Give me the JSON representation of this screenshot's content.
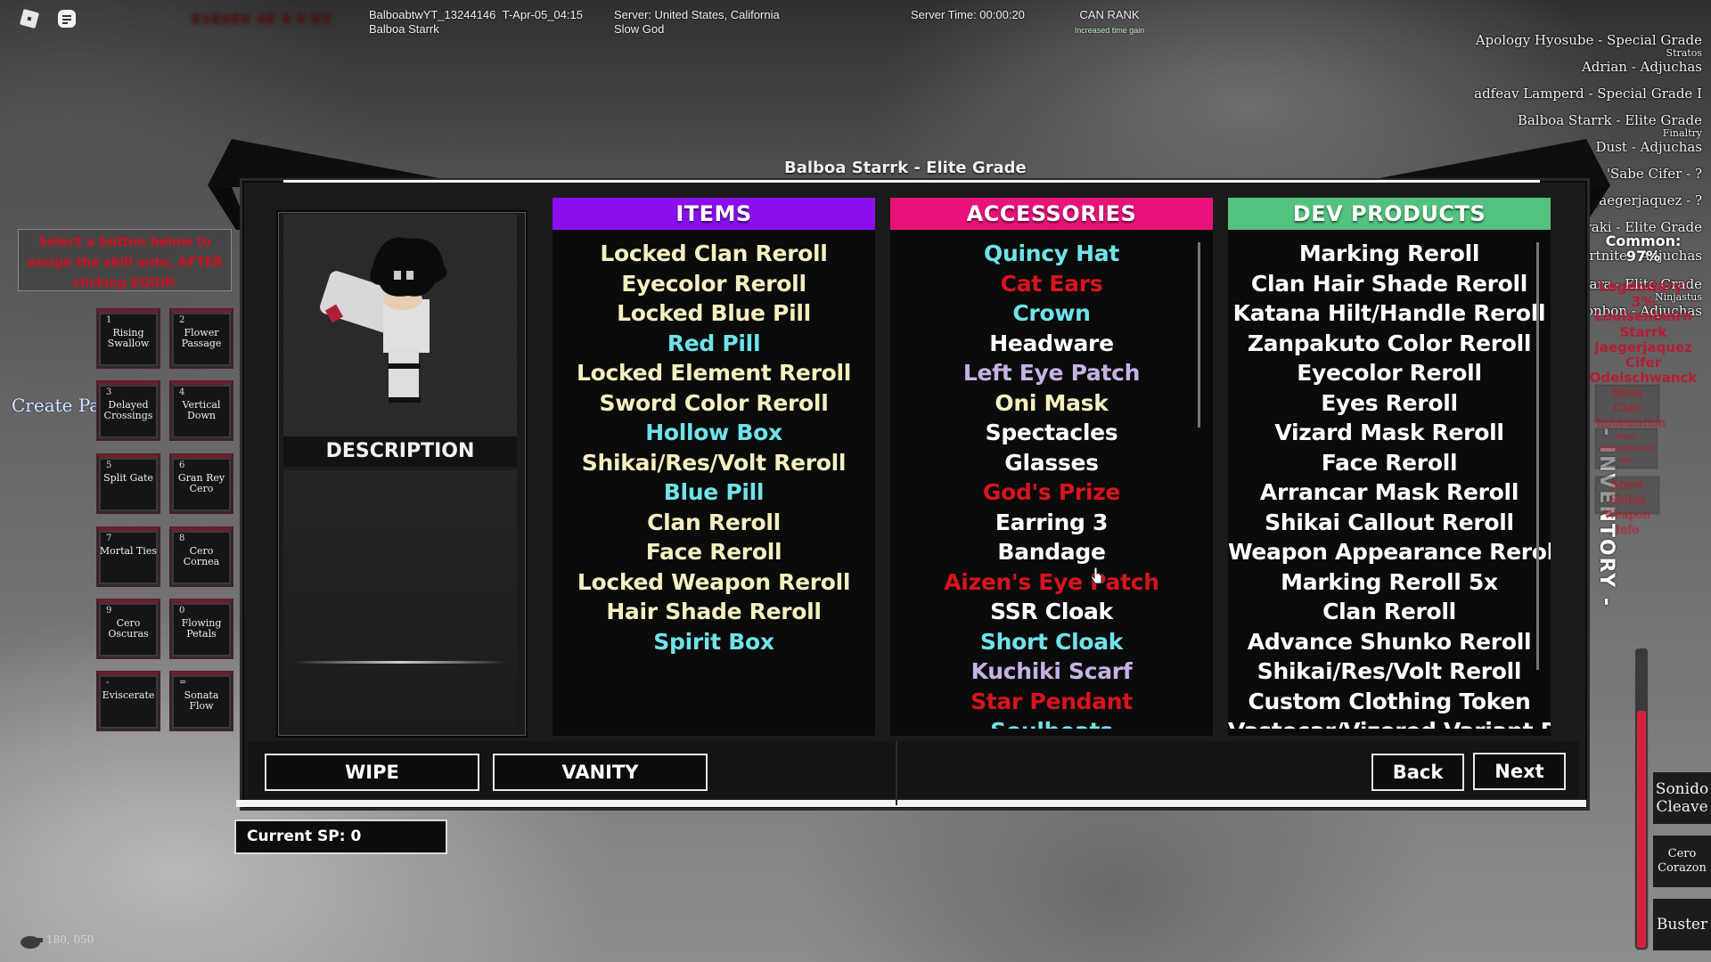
{
  "topbar": {
    "blurred_text": "E1E3E0 4E 9 0 E3",
    "player_id": "BalboabtwYT_13244146",
    "session": "T-Apr-05_04:15",
    "player_name": "Balboa Starrk",
    "server": "Server: United States, California",
    "server_sub": "Slow God",
    "server_time": "Server Time: 00:00:20",
    "rank_title": "CAN RANK",
    "rank_sub": "Increased time gain"
  },
  "leaderboard": [
    {
      "text": "Apology Hyosube - Special Grade",
      "sub": "Stratos"
    },
    {
      "text": "Adrian  - Adjuchas",
      "sub": ""
    },
    {
      "text": "adfeav Lamperd - Special Grade I",
      "sub": ""
    },
    {
      "text": "Balboa Starrk - Elite Grade",
      "sub": "Finaltry"
    },
    {
      "text": "Dust  - Adjuchas",
      "sub": ""
    },
    {
      "text": "'Sabe Cifer - ?",
      "sub": ""
    },
    {
      "text": "Jaegerjaquez - ?",
      "sub": ""
    },
    {
      "text": "Zaraki - Elite Grade",
      "sub": ""
    },
    {
      "text": "Fortnite  - Adjuchas",
      "sub": ""
    },
    {
      "text": "hutara - Elite Grade",
      "sub": "Ninjastus"
    },
    {
      "text": "bonbon  - Adjuchas",
      "sub": ""
    }
  ],
  "drop_rates": {
    "common": "Common: 97%",
    "legendary": "Legendary: 3%",
    "names": [
      "Louisenbairn",
      "Starrk",
      "Jaegerjaquez",
      "Cifer",
      "Odelschwanck"
    ]
  },
  "hint": "Select a button below to assign the skill onto, AFTER clicking EQUIP.",
  "create_party": "Create Party",
  "skills": [
    {
      "key": "1",
      "name": "Rising Swallow"
    },
    {
      "key": "2",
      "name": "Flower Passage"
    },
    {
      "key": "3",
      "name": "Delayed Crossings"
    },
    {
      "key": "4",
      "name": "Vertical Down"
    },
    {
      "key": "5",
      "name": "Split Gate"
    },
    {
      "key": "6",
      "name": "Gran Rey Cero"
    },
    {
      "key": "7",
      "name": "Mortal Ties"
    },
    {
      "key": "8",
      "name": "Cero Cornea"
    },
    {
      "key": "9",
      "name": "Cero Oscuras"
    },
    {
      "key": "0",
      "name": "Flowing Petals"
    },
    {
      "key": "-",
      "name": "Eviscerate"
    },
    {
      "key": "=",
      "name": "Sonata Flow"
    }
  ],
  "panel": {
    "title": "Balboa Starrk - Elite Grade",
    "description_label": "DESCRIPTION",
    "columns": [
      {
        "header": "ITEMS",
        "color": "#8a0ef0",
        "items": [
          {
            "label": "Locked Clan Reroll",
            "color": "#f4f0c0"
          },
          {
            "label": "Eyecolor Reroll",
            "color": "#f4f0c0"
          },
          {
            "label": "Locked Blue Pill",
            "color": "#f4f0c0"
          },
          {
            "label": "Red Pill",
            "color": "#6fe3ea"
          },
          {
            "label": "Locked Element Reroll",
            "color": "#f4f0c0"
          },
          {
            "label": "Sword Color Reroll",
            "color": "#f4f0c0"
          },
          {
            "label": "Hollow Box",
            "color": "#6fe3ea"
          },
          {
            "label": "Shikai/Res/Volt Reroll",
            "color": "#f4f0c0"
          },
          {
            "label": "Blue Pill",
            "color": "#6fe3ea"
          },
          {
            "label": "Clan Reroll",
            "color": "#f4f0c0"
          },
          {
            "label": "Face Reroll",
            "color": "#f4f0c0"
          },
          {
            "label": "Locked Weapon Reroll",
            "color": "#f4f0c0"
          },
          {
            "label": "Hair Shade Reroll",
            "color": "#f4f0c0"
          },
          {
            "label": "Spirit Box",
            "color": "#6fe3ea"
          }
        ]
      },
      {
        "header": "ACCESSORIES",
        "color": "#e8127a",
        "items": [
          {
            "label": "Quincy Hat",
            "color": "#6fe3ea"
          },
          {
            "label": "Cat Ears",
            "color": "#d8141e"
          },
          {
            "label": "Crown",
            "color": "#6fe3ea"
          },
          {
            "label": "Headware",
            "color": "#ffffff"
          },
          {
            "label": "Left Eye Patch",
            "color": "#c6b2e6"
          },
          {
            "label": "Oni Mask",
            "color": "#f4f0c0"
          },
          {
            "label": "Spectacles",
            "color": "#ffffff"
          },
          {
            "label": "Glasses",
            "color": "#ffffff"
          },
          {
            "label": "God's Prize",
            "color": "#d8141e"
          },
          {
            "label": "Earring 3",
            "color": "#ffffff"
          },
          {
            "label": "Bandage",
            "color": "#ffffff"
          },
          {
            "label": "Aizen's Eye Patch",
            "color": "#d8141e"
          },
          {
            "label": "SSR Cloak",
            "color": "#ffffff"
          },
          {
            "label": "Short Cloak",
            "color": "#6fe3ea"
          },
          {
            "label": "Kuchiki Scarf",
            "color": "#c6b2e6"
          },
          {
            "label": "Star Pendant",
            "color": "#d8141e"
          },
          {
            "label": "Soulbeats",
            "color": "#6fe3ea"
          }
        ]
      },
      {
        "header": "DEV PRODUCTS",
        "color": "#52c27e",
        "items": [
          {
            "label": "Marking Reroll",
            "color": "#ffffff"
          },
          {
            "label": "Clan Hair Shade Reroll",
            "color": "#ffffff"
          },
          {
            "label": "Katana Hilt/Handle Reroll",
            "color": "#ffffff"
          },
          {
            "label": "Zanpakuto Color Reroll",
            "color": "#ffffff"
          },
          {
            "label": "Eyecolor Reroll",
            "color": "#ffffff"
          },
          {
            "label": "Eyes Reroll",
            "color": "#ffffff"
          },
          {
            "label": "Vizard Mask Reroll",
            "color": "#ffffff"
          },
          {
            "label": "Face Reroll",
            "color": "#ffffff"
          },
          {
            "label": "Arrancar Mask Reroll",
            "color": "#ffffff"
          },
          {
            "label": "Shikai Callout Reroll",
            "color": "#ffffff"
          },
          {
            "label": "Weapon Appearance Reroll",
            "color": "#ffffff"
          },
          {
            "label": "Marking Reroll 5x",
            "color": "#ffffff"
          },
          {
            "label": "Clan Reroll",
            "color": "#ffffff"
          },
          {
            "label": "Advance Shunko Reroll",
            "color": "#ffffff"
          },
          {
            "label": "Shikai/Res/Volt Reroll",
            "color": "#ffffff"
          },
          {
            "label": "Custom Clothing Token",
            "color": "#ffffff"
          },
          {
            "label": "Vastocar/Vizored Variant Reroll",
            "color": "#ffffff"
          }
        ]
      }
    ],
    "buttons": {
      "wipe": "WIPE",
      "vanity": "VANITY",
      "back": "Back",
      "next": "Next"
    }
  },
  "current_sp": "Current SP: 0",
  "inventory_label": "- INVENTORY -",
  "side_buttons": [
    "Show Clan Information",
    "Show Shikai/Res/Volt Info",
    "Show Shikai Weapon Info"
  ],
  "health_fraction": 0.8,
  "abilities": [
    "Sonido Cleave",
    "Cero Corazon",
    "Buster"
  ],
  "coords": "180, 050"
}
